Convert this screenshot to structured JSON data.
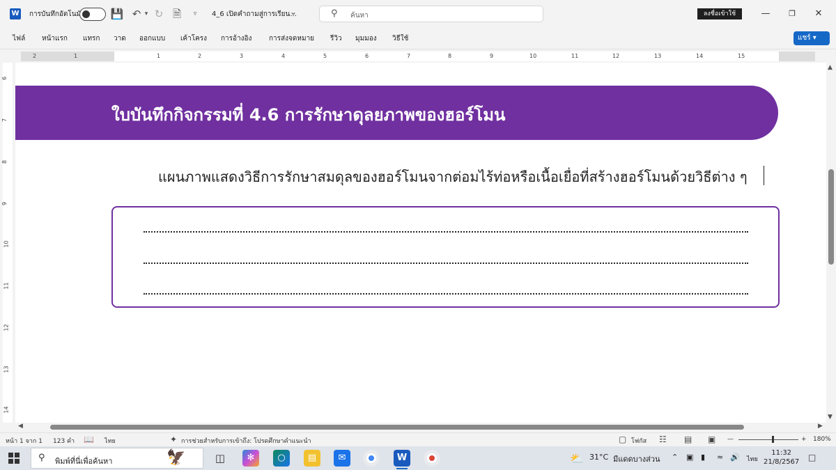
{
  "app": {
    "autosave_label": "การบันทึกอัตโนมัติ",
    "doc_title": "4_6 เปิดคำถามสู่การเรียน...",
    "search_placeholder": "ค้นหา",
    "signin_label": "ลงชื่อเข้าใช้",
    "share_label": "แชร์"
  },
  "ribbon": {
    "tabs": [
      "ไฟล์",
      "หน้าแรก",
      "แทรก",
      "วาด",
      "ออกแบบ",
      "เค้าโครง",
      "การอ้างอิง",
      "การส่งจดหมาย",
      "รีวิว",
      "มุมมอง",
      "วิธีใช้"
    ]
  },
  "ruler": {
    "h_numbers": [
      "1",
      "2",
      "1",
      "2",
      "3",
      "4",
      "5",
      "6",
      "7",
      "8",
      "9",
      "10",
      "11",
      "12",
      "13",
      "14",
      "15"
    ],
    "v_numbers": [
      "6",
      "7",
      "8",
      "9",
      "10",
      "11",
      "12",
      "13",
      "14"
    ]
  },
  "document": {
    "banner_title": "ใบบันทึกกิจกรรมที่   4.6     การรักษาดุลยภาพของฮอร์โมน",
    "instruction": "แผนภาพแสดงวิธีการรักษาสมดุลของฮอร์โมนจากต่อมไร้ท่อหรือเนื้อเยื่อที่สร้างฮอร์โมนด้วยวิธีต่าง ๆ",
    "answer_lines": 3,
    "accent_color": "#7030a0"
  },
  "status": {
    "page": "หน้า 1 จาก 1",
    "words": "123 คำ",
    "language": "ไทย",
    "accessibility": "การช่วยสำหรับการเข้าถึง: โปรดศึกษาคำแนะนำ",
    "focus": "โฟกัส",
    "zoom": "180%"
  },
  "taskbar": {
    "search_text": "พิมพ์ที่นี่เพื่อค้นหา",
    "weather": "31°C",
    "weather_desc": "มีแดดบางส่วน",
    "language": "ไทย",
    "time": "11:32",
    "date": "21/8/2567"
  }
}
